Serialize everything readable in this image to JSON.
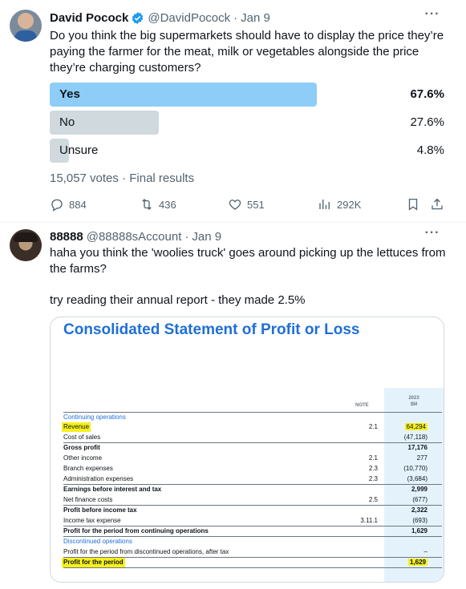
{
  "tweet1": {
    "name": "David Pocock",
    "handle": "@DavidPocock",
    "date": "Jan 9",
    "more": "···",
    "text": "Do you think the big supermarkets should have to display the price they’re paying the farmer for the meat, milk or vegetables alongside the price they’re charging customers?",
    "poll": {
      "options": [
        {
          "label": "Yes",
          "percent": "67.6%",
          "fraction": 0.676
        },
        {
          "label": "No",
          "percent": "27.6%",
          "fraction": 0.276
        },
        {
          "label": "Unsure",
          "percent": "4.8%",
          "fraction": 0.048
        }
      ],
      "meta": "15,057 votes · Final results"
    },
    "actions": {
      "replies": "884",
      "reposts": "436",
      "likes": "551",
      "views": "292K"
    }
  },
  "tweet2": {
    "name": "88888",
    "handle": "@88888sAccount",
    "date": "Jan 9",
    "more": "···",
    "text1": "haha you think the 'woolies truck' goes around picking up the lettuces from the farms?",
    "text2": "try reading their annual report - they made 2.5%",
    "report": {
      "title": "Consolidated Statement of Profit or Loss",
      "note_header": "NOTE",
      "year_header": "2023",
      "unit_header": "$M",
      "rows": [
        {
          "label": "Continuing operations",
          "note": "",
          "value": ""
        },
        {
          "label": "Revenue",
          "note": "2.1",
          "value": "64,294"
        },
        {
          "label": "Cost of sales",
          "note": "",
          "value": "(47,118)"
        },
        {
          "label": "Gross profit",
          "note": "",
          "value": "17,176"
        },
        {
          "label": "Other income",
          "note": "2.1",
          "value": "277"
        },
        {
          "label": "Branch expenses",
          "note": "2.3",
          "value": "(10,770)"
        },
        {
          "label": "Administration expenses",
          "note": "2.3",
          "value": "(3,684)"
        },
        {
          "label": "Earnings before interest and tax",
          "note": "",
          "value": "2,999"
        },
        {
          "label": "Net finance costs",
          "note": "2.5",
          "value": "(677)"
        },
        {
          "label": "Profit before income tax",
          "note": "",
          "value": "2,322"
        },
        {
          "label": "Income tax expense",
          "note": "3.11.1",
          "value": "(693)"
        },
        {
          "label": "Profit for the period from continuing operations",
          "note": "",
          "value": "1,629"
        },
        {
          "label": "Discontinued operations",
          "note": "",
          "value": ""
        },
        {
          "label": "Profit for the period from discontinued operations, after tax",
          "note": "",
          "value": "–"
        },
        {
          "label": "Profit for the period",
          "note": "",
          "value": "1,629"
        }
      ]
    }
  },
  "colors": {
    "accent": "#1d9bf0",
    "poll_winner": "#8ecdf7",
    "poll_other": "#cfd9de",
    "report_title": "#1e6fd9",
    "highlight": "#f6f01f"
  }
}
